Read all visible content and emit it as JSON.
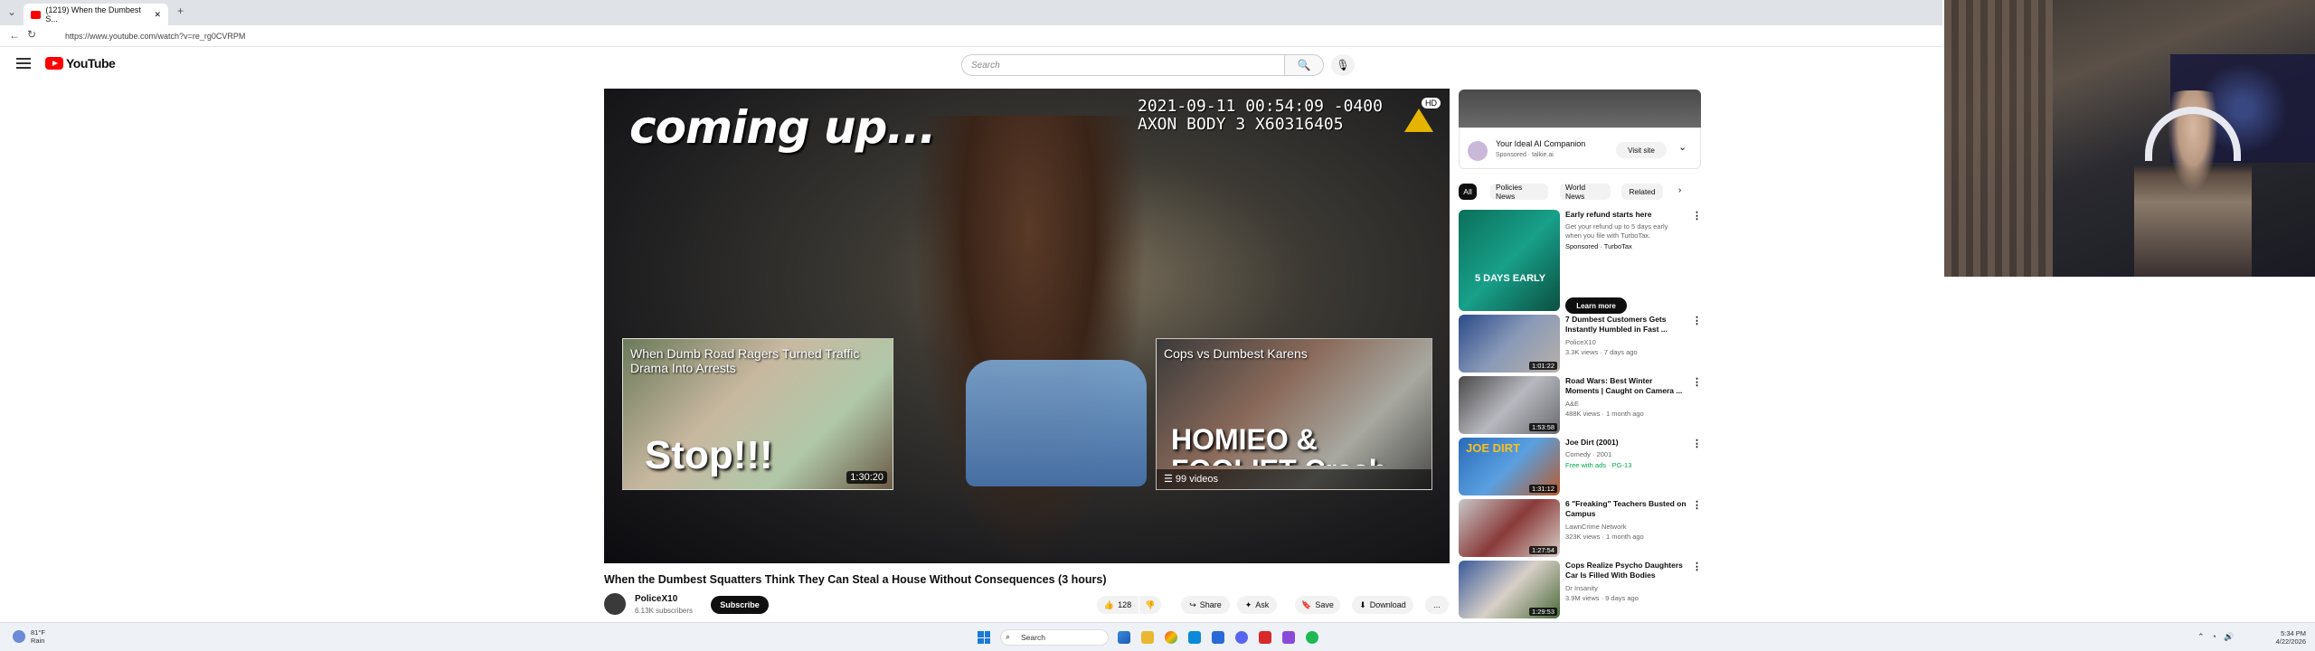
{
  "browser": {
    "tab_title": "(1219) When the Dumbest S...",
    "new_tab": "+",
    "url": "https://www.youtube.com/watch?v=re_rg0CVRPM"
  },
  "youtube": {
    "logo_text": "YouTube",
    "search_placeholder": "Search"
  },
  "player": {
    "overlay_text": "coming up...",
    "timestamp": "2021-09-11 00:54:09 -0400\nAXON BODY 3 X60316405",
    "hd_badge": "HD",
    "endcards": [
      {
        "title": "When Dumb Road Ragers Turned Traffic Drama Into Arrests",
        "big": "Stop!!!",
        "duration": "1:30:20"
      },
      {
        "title": "Cops vs Dumbest Karens",
        "big": "HOMIEO & FOOLIET Crash",
        "playlist": "99 videos"
      }
    ]
  },
  "video": {
    "title": "When the Dumbest Squatters Think They Can Steal a House Without Consequences (3 hours)",
    "channel": "PoliceX10",
    "subs": "6.13K subscribers",
    "subscribe": "Subscribe",
    "actions": [
      "128",
      "",
      "Share",
      "Ask",
      "Save",
      "Download",
      "..."
    ]
  },
  "ad": {
    "title": "Your Ideal AI Companion",
    "sponsored": "Sponsored · talkie.ai",
    "visit": "Visit site"
  },
  "chips": [
    "All",
    "Policies News",
    "World News",
    "Related"
  ],
  "recs": [
    {
      "title": "Early refund starts here",
      "meta1": "Get your refund up to 5 days early",
      "meta2": "when you file with TurboTax.",
      "meta3": "Sponsored · TurboTax",
      "duration": "",
      "cta": "Learn more",
      "thumb_text": "5 DAYS EARLY"
    },
    {
      "title": "7 Dumbest Customers Gets Instantly Humbled in Fast ...",
      "meta1": "PoliceX10",
      "meta2": "3.3K views · 7 days ago",
      "duration": "1:01:22"
    },
    {
      "title": "Road Wars: Best Winter Moments | Caught on Camera ...",
      "meta1": "A&E",
      "meta2": "488K views · 1 month ago",
      "duration": "1:53:58"
    },
    {
      "title": "Joe Dirt (2001)",
      "meta1": "Comedy · 2001",
      "meta2": "Free with ads · PG-13",
      "duration": "1:31:12",
      "thumb_text": "JOE DIRT"
    },
    {
      "title": "6 \"Freaking\" Teachers Busted on Campus",
      "meta1": "LawnCrime Network",
      "meta2": "323K views · 1 month ago",
      "duration": "1:27:54"
    },
    {
      "title": "Cops Realize Psycho Daughters Car Is Filled With Bodies",
      "meta1": "Dr Insanity",
      "meta2": "3.9M views · 9 days ago",
      "duration": "1:29:53"
    }
  ],
  "taskbar": {
    "weather_temp": "81°F",
    "weather_cond": "Rain",
    "search": "Search",
    "time": "5:34 PM",
    "date": "4/22/2026"
  }
}
